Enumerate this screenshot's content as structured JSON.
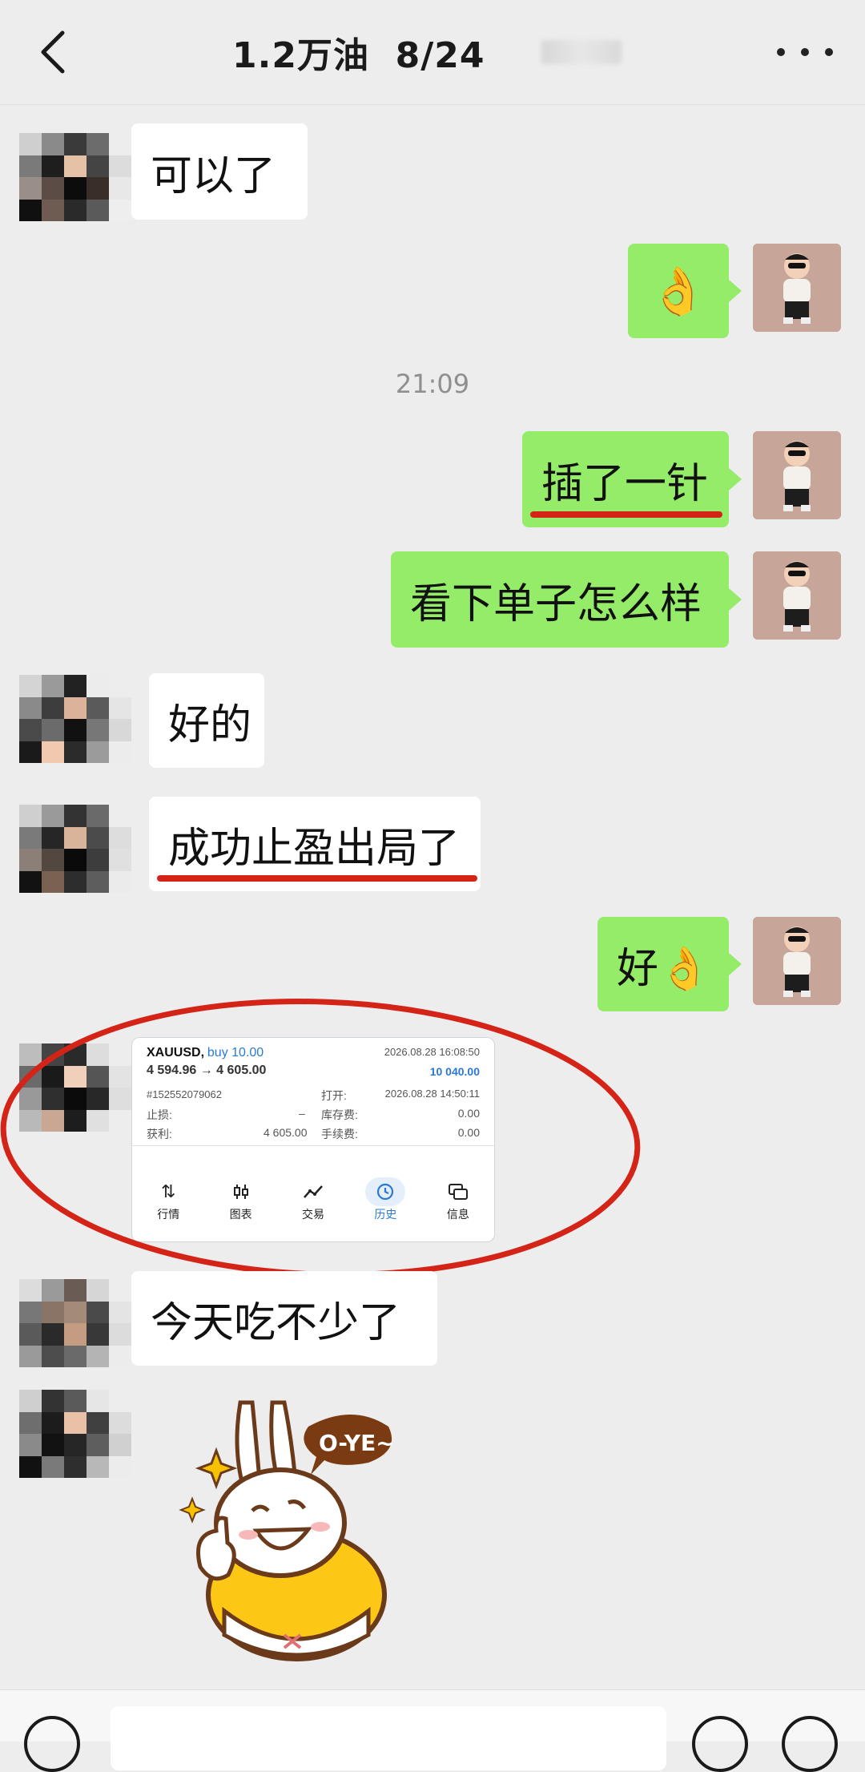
{
  "header": {
    "title": "1.2万油  8/24"
  },
  "icons": {
    "back": "chevron-left-icon",
    "more": "more-icon"
  },
  "messages": [
    {
      "side": "left",
      "text": "可以了"
    },
    {
      "side": "right",
      "text": "👌"
    },
    {
      "side": "right",
      "text": "插了一针"
    },
    {
      "side": "right",
      "text": "看下单子怎么样"
    },
    {
      "side": "left",
      "text": "好的"
    },
    {
      "side": "left",
      "text": "成功止盈出局了"
    },
    {
      "side": "right",
      "text": "好👌"
    },
    {
      "side": "left",
      "text": "今天吃不少了"
    }
  ],
  "timestamp": "21:09",
  "trade_card": {
    "symbol": "XAUUSD,",
    "direction": "buy 10.00",
    "prices": "4 594.96 → 4 605.00",
    "close_time": "2026.08.28 16:08:50",
    "profit_total": "10 040.00",
    "order_id": "#152552079062",
    "open_label": "打开:",
    "open_time": "2026.08.28 14:50:11",
    "sl_label": "止损:",
    "sl_value": "–",
    "swap_label": "库存费:",
    "swap_value": "0.00",
    "tp_label": "获利:",
    "tp_value": "4 605.00",
    "fee_label": "手续费:",
    "fee_value": "0.00",
    "nav": [
      "行情",
      "图表",
      "交易",
      "历史",
      "信息"
    ],
    "active_nav": "历史"
  },
  "sticker_text": "O-YE~",
  "colors": {
    "bg": "#ededed",
    "bubble_right": "#95ec69",
    "bubble_left": "#ffffff",
    "annotation_red": "#d42418",
    "accent_blue": "#2a7ad5"
  }
}
